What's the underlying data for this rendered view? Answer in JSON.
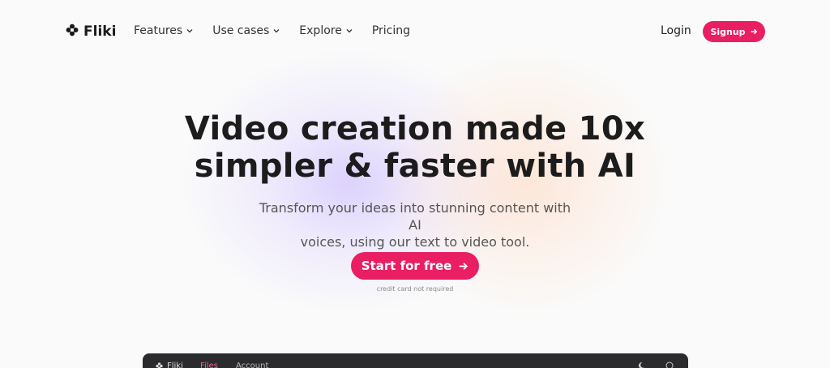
{
  "nav": {
    "brand": "Fliki",
    "links": [
      {
        "label": "Features",
        "has_dropdown": true
      },
      {
        "label": "Use cases",
        "has_dropdown": true
      },
      {
        "label": "Explore",
        "has_dropdown": true
      },
      {
        "label": "Pricing",
        "has_dropdown": false
      }
    ],
    "login_label": "Login",
    "signup_label": "Signup"
  },
  "hero": {
    "headline_line1": "Video creation made 10x",
    "headline_line2": "simpler & faster with AI",
    "subtitle_line1": "Transform your ideas into stunning content with AI",
    "subtitle_line2": "voices, using our text to video tool.",
    "cta_label": "Start for free",
    "cta_note": "credit card not required"
  },
  "app_preview": {
    "brand": "Fliki",
    "tabs": [
      {
        "label": "Files",
        "active": true
      },
      {
        "label": "Account",
        "active": false
      }
    ]
  },
  "colors": {
    "accent": "#e91e63",
    "page_background": "#fafafa",
    "app_bar": "#2b2b2e",
    "active_tab": "#ff5c8a"
  },
  "icons": [
    "flower-logo-icon",
    "chevron-down-icon",
    "arrow-right-icon",
    "moon-icon",
    "help-icon"
  ]
}
